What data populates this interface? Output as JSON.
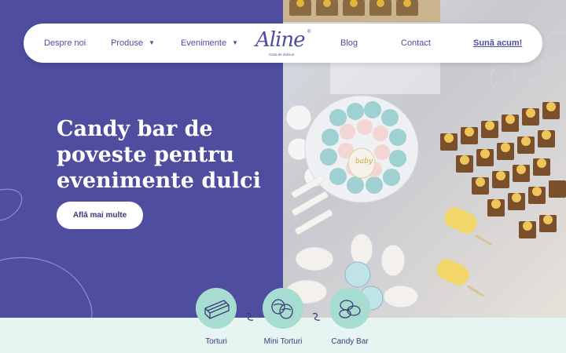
{
  "nav": {
    "items": [
      {
        "label": "Despre noi"
      },
      {
        "label": "Produse"
      },
      {
        "label": "Evenimente"
      },
      {
        "label": "Blog"
      },
      {
        "label": "Contact"
      }
    ],
    "cta": "Sună acum!",
    "logo_name": "Aline",
    "logo_tagline": "Casa de dulciuri",
    "logo_mark": "®"
  },
  "hero": {
    "title_lines": [
      "Candy bar de",
      "poveste pentru",
      "evenimente dulci"
    ],
    "button": "Află mai multe",
    "cookie_text": "baby"
  },
  "categories": [
    {
      "label": "Torturi",
      "icon": "cake-icon"
    },
    {
      "label": "Mini Torturi",
      "icon": "mini-cake-icon"
    },
    {
      "label": "Candy Bar",
      "icon": "candy-icon"
    }
  ],
  "colors": {
    "brand": "#4f4d9f",
    "white": "#ffffff",
    "mint": "#a6ddd0",
    "strip": "#e7f5f2"
  }
}
